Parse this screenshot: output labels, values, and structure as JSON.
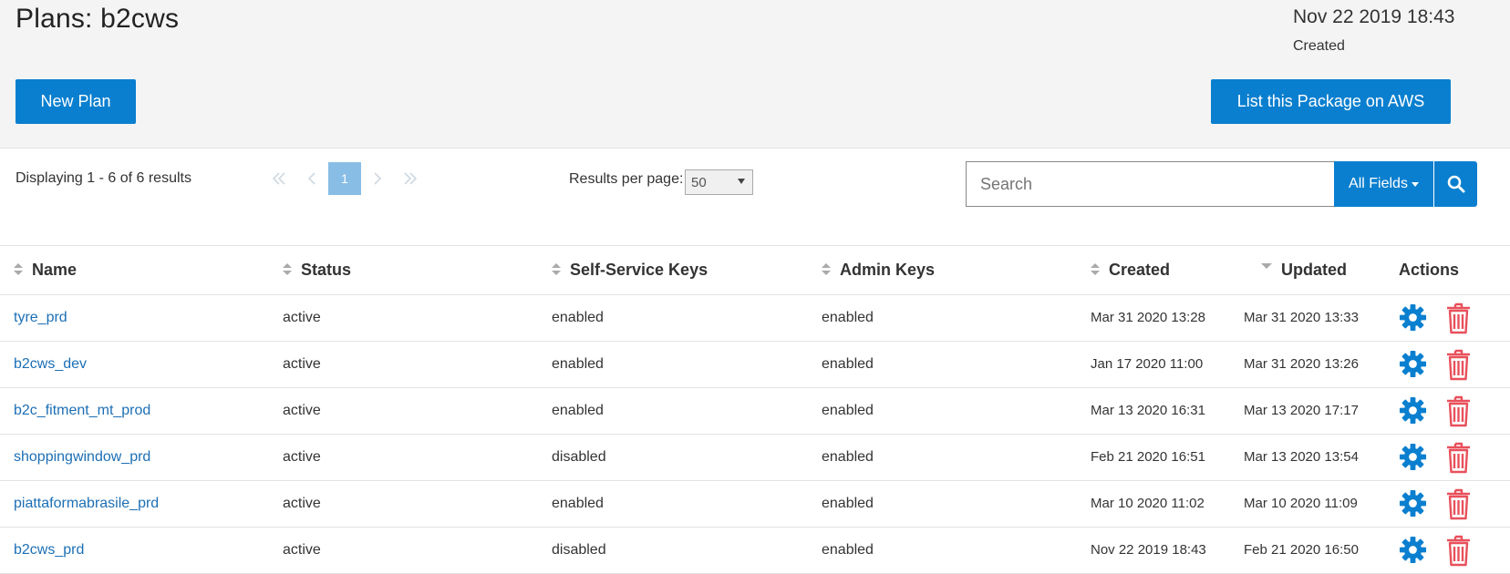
{
  "header": {
    "title": "Plans: b2cws",
    "created_date": "Nov 22 2019 18:43",
    "created_label": "Created",
    "new_plan_label": "New Plan",
    "list_aws_label": "List this Package on AWS"
  },
  "toolbar": {
    "displaying": "Displaying 1 - 6 of 6 results",
    "current_page": "1",
    "results_per_page_label": "Results per page:",
    "results_per_page_value": "50",
    "search_placeholder": "Search",
    "search_field_label": "All Fields"
  },
  "table": {
    "columns": [
      "Name",
      "Status",
      "Self-Service Keys",
      "Admin Keys",
      "Created",
      "Updated",
      "Actions"
    ],
    "rows": [
      {
        "name": "tyre_prd",
        "status": "active",
        "self_service": "enabled",
        "admin": "enabled",
        "created": "Mar 31 2020 13:28",
        "updated": "Mar 31 2020 13:33"
      },
      {
        "name": "b2cws_dev",
        "status": "active",
        "self_service": "enabled",
        "admin": "enabled",
        "created": "Jan 17 2020 11:00",
        "updated": "Mar 31 2020 13:26"
      },
      {
        "name": "b2c_fitment_mt_prod",
        "status": "active",
        "self_service": "enabled",
        "admin": "enabled",
        "created": "Mar 13 2020 16:31",
        "updated": "Mar 13 2020 17:17"
      },
      {
        "name": "shoppingwindow_prd",
        "status": "active",
        "self_service": "disabled",
        "admin": "enabled",
        "created": "Feb 21 2020 16:51",
        "updated": "Mar 13 2020 13:54"
      },
      {
        "name": "piattaformabrasile_prd",
        "status": "active",
        "self_service": "enabled",
        "admin": "enabled",
        "created": "Mar 10 2020 11:02",
        "updated": "Mar 10 2020 11:09"
      },
      {
        "name": "b2cws_prd",
        "status": "active",
        "self_service": "disabled",
        "admin": "enabled",
        "created": "Nov 22 2019 18:43",
        "updated": "Feb 21 2020 16:50"
      }
    ]
  },
  "colors": {
    "accent": "#0a7fcf",
    "link": "#1c6fb5",
    "gear": "#0a7fcf",
    "trash": "#e8505b"
  },
  "icons": {
    "first_page": "double-chevron-left-icon",
    "prev_page": "chevron-left-icon",
    "next_page": "chevron-right-icon",
    "last_page": "double-chevron-right-icon",
    "search": "magnifier-icon",
    "settings": "gear-icon",
    "delete": "trash-icon"
  }
}
